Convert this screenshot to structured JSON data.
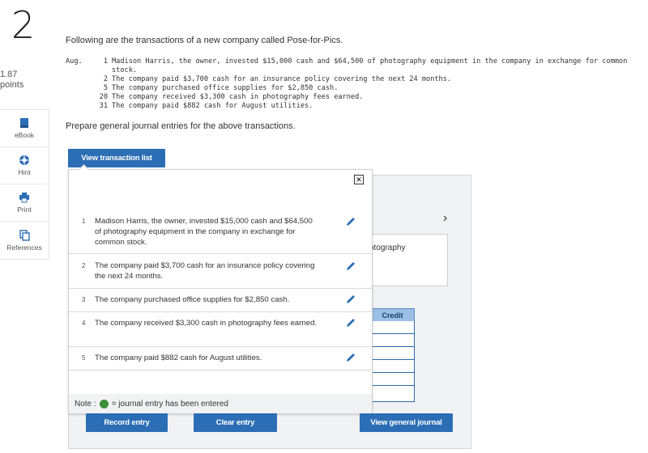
{
  "question": {
    "number": "2",
    "points_value": "1.87",
    "points_label": "points"
  },
  "sidebar": [
    {
      "label": "eBook",
      "icon": "book-icon"
    },
    {
      "label": "Hint",
      "icon": "lifebuoy-icon"
    },
    {
      "label": "Print",
      "icon": "printer-icon"
    },
    {
      "label": "References",
      "icon": "copy-icon"
    }
  ],
  "intro": "Following are the transactions of a new company called Pose-for-Pics.",
  "transactions": {
    "month": "Aug.",
    "rows": [
      {
        "day": "1",
        "text": "Madison Harris, the owner, invested $15,000 cash and $64,500 of photography equipment in the company in exchange for common\nstock."
      },
      {
        "day": "2",
        "text": "The company paid $3,700 cash for an insurance policy covering the next 24 months."
      },
      {
        "day": "5",
        "text": "The company purchased office supplies for $2,850 cash."
      },
      {
        "day": "20",
        "text": "The company received $3,300 cash in photography fees earned."
      },
      {
        "day": "31",
        "text": "The company paid $882 cash for August utilities."
      }
    ]
  },
  "prepare": "Prepare general journal entries for the above transactions.",
  "buttons": {
    "view_transaction_list": "View transaction list",
    "record_entry": "Record entry",
    "clear_entry": "Clear entry",
    "view_general_journal": "View general journal"
  },
  "background_form": {
    "description_partial": "otography",
    "credit_header": "Credit",
    "chevron": "›"
  },
  "popup": {
    "close": "✕",
    "items": [
      {
        "num": "1",
        "text": "Madison Harris, the owner, invested $15,000 cash and $64,500 of photography equipment in the company in exchange for common stock."
      },
      {
        "num": "2",
        "text": "The company paid $3,700 cash for an insurance policy covering the next 24 months."
      },
      {
        "num": "3",
        "text": "The company purchased office supplies for $2,850 cash."
      },
      {
        "num": "4",
        "text": "The company received $3,300 cash in photography fees earned."
      },
      {
        "num": "5",
        "text": "The company paid $882 cash for August utilities."
      }
    ],
    "note_prefix": "Note :",
    "note_suffix": "= journal entry has been entered"
  },
  "colors": {
    "button_blue": "#2c6eb5",
    "entered_green": "#3a8f3a",
    "credit_header": "#9bbfe6"
  }
}
